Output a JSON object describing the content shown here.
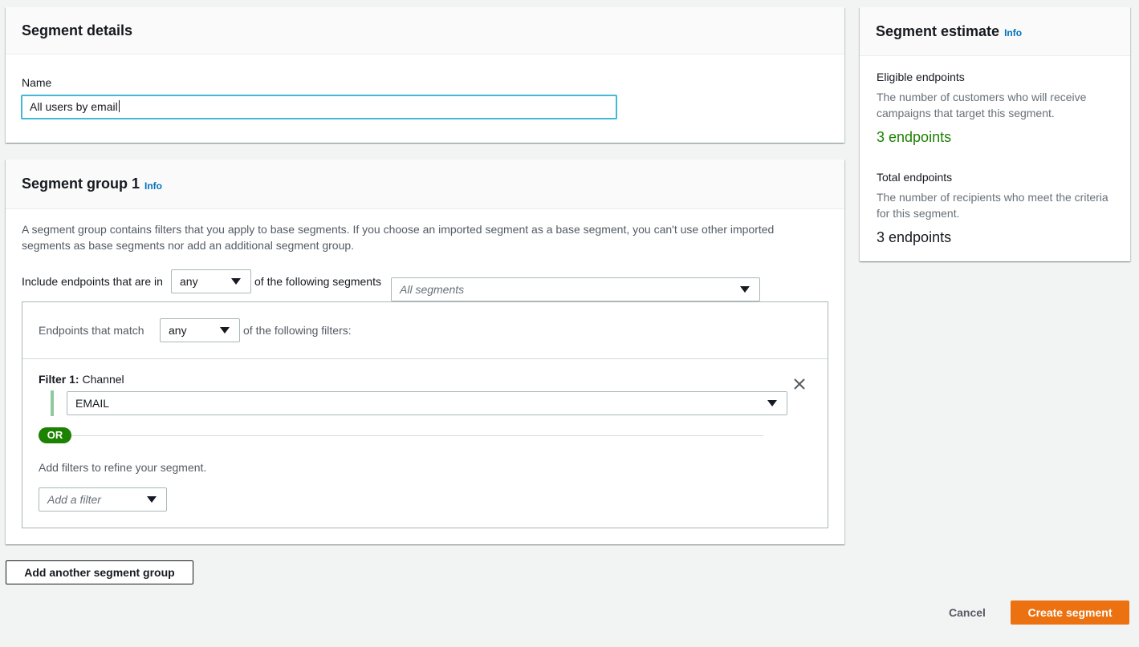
{
  "details": {
    "title": "Segment details",
    "name_label": "Name",
    "name_value": "All users by email"
  },
  "group": {
    "title": "Segment group 1",
    "info": "Info",
    "description": "A segment group contains filters that you apply to base segments. If you choose an imported segment as a base segment, you can't use other imported segments as base segments nor add an additional segment group.",
    "include_prefix": "Include endpoints that are in",
    "include_select": "any",
    "include_suffix": "of the following segments",
    "segments_placeholder": "All segments",
    "match_prefix": "Endpoints that match",
    "match_select": "any",
    "match_suffix": "of the following filters:",
    "filter": {
      "number_label": "Filter 1:",
      "type": "Channel",
      "value": "EMAIL"
    },
    "or_label": "OR",
    "add_filters_text": "Add filters to refine your segment.",
    "add_filter_placeholder": "Add a filter"
  },
  "actions": {
    "add_group": "Add another segment group",
    "cancel": "Cancel",
    "create": "Create segment"
  },
  "estimate": {
    "title": "Segment estimate",
    "info": "Info",
    "eligible_label": "Eligible endpoints",
    "eligible_desc": "The number of customers who will receive campaigns that target this segment.",
    "eligible_value": "3 endpoints",
    "total_label": "Total endpoints",
    "total_desc": "The number of recipients who meet the criteria for this segment.",
    "total_value": "3 endpoints"
  },
  "colors": {
    "accent": "#ec7211",
    "link": "#0073bb",
    "success": "#1d8102",
    "focus": "#44b9d6"
  }
}
